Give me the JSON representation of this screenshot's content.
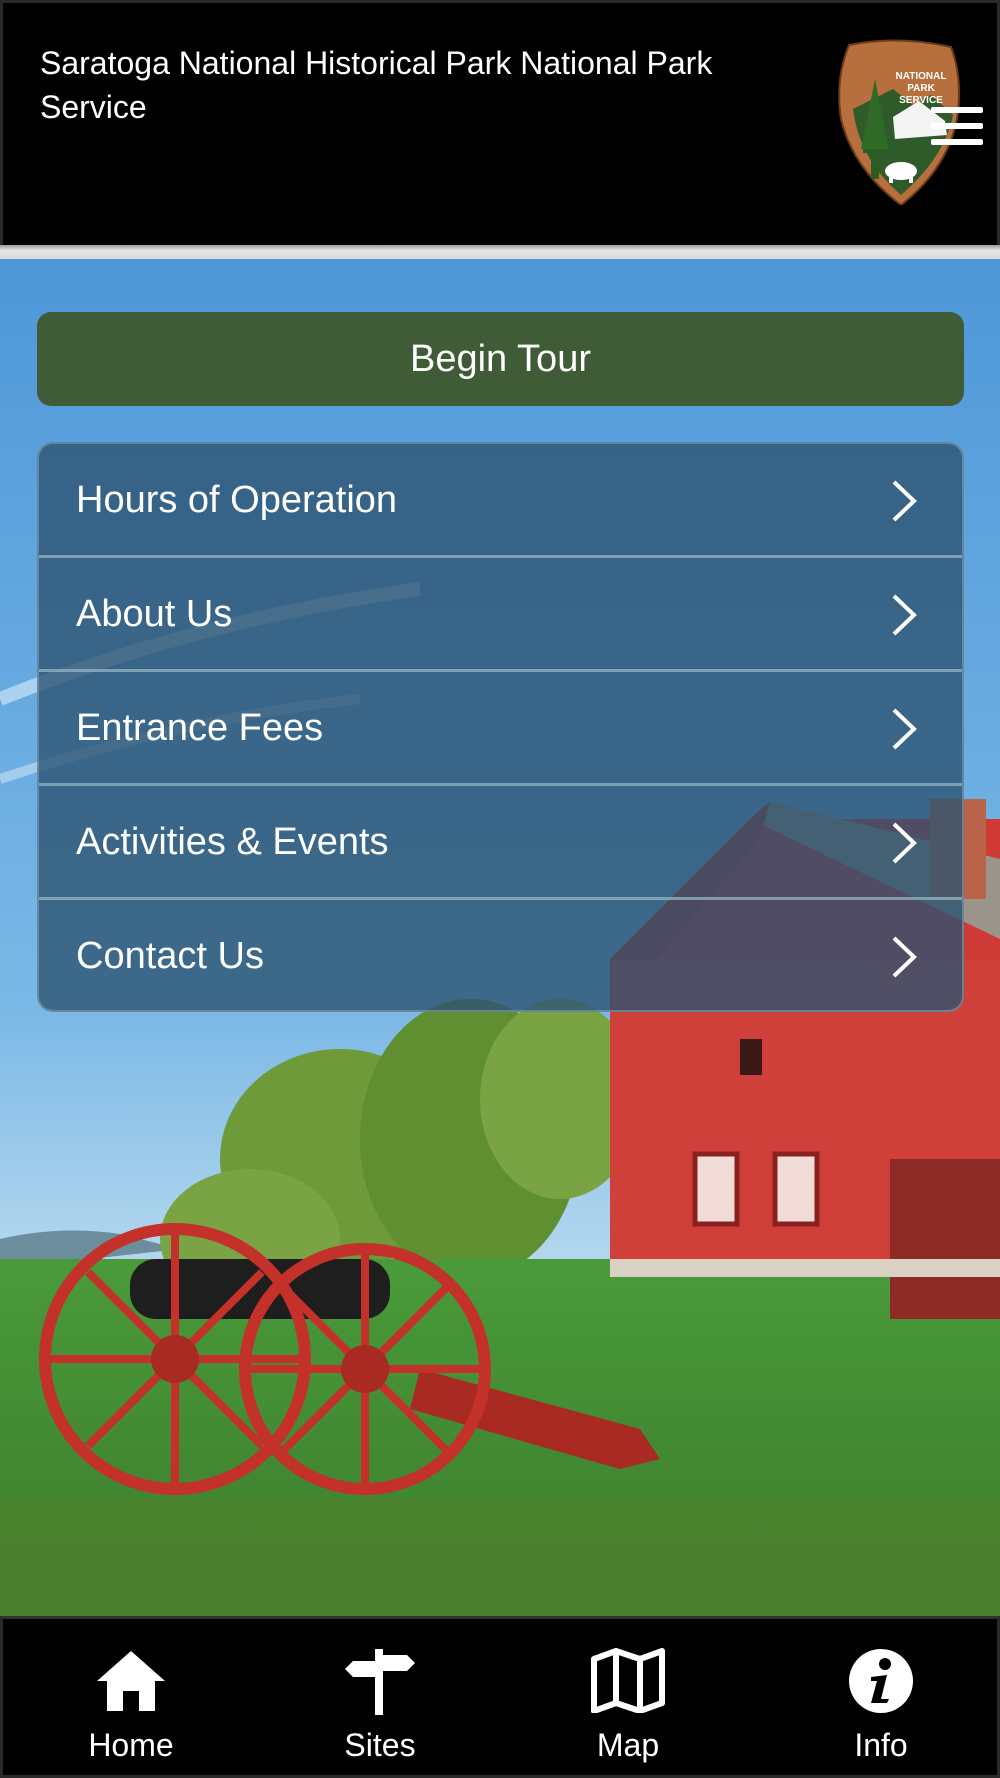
{
  "header": {
    "title": "Saratoga National Historical Park National Park Service",
    "logo": {
      "icon": "nps-arrowhead-logo",
      "text_lines": [
        "NATIONAL",
        "PARK",
        "SERVICE"
      ]
    },
    "menu_icon": "hamburger-menu-icon"
  },
  "main": {
    "begin_tour_label": "Begin Tour",
    "menu_items": [
      {
        "label": "Hours of Operation",
        "icon": "chevron-right-icon"
      },
      {
        "label": "About Us",
        "icon": "chevron-right-icon"
      },
      {
        "label": "Entrance Fees",
        "icon": "chevron-right-icon"
      },
      {
        "label": "Activities & Events",
        "icon": "chevron-right-icon"
      },
      {
        "label": "Contact Us",
        "icon": "chevron-right-icon"
      }
    ]
  },
  "tabbar": {
    "tabs": [
      {
        "label": "Home",
        "icon": "home-icon"
      },
      {
        "label": "Sites",
        "icon": "signpost-icon"
      },
      {
        "label": "Map",
        "icon": "map-icon"
      },
      {
        "label": "Info",
        "icon": "info-icon"
      }
    ]
  },
  "colors": {
    "header_bg": "#000000",
    "begin_tour_bg": "#3f5c36",
    "menu_panel_bg": "#2c5270",
    "tabbar_bg": "#000000",
    "text": "#ffffff"
  }
}
